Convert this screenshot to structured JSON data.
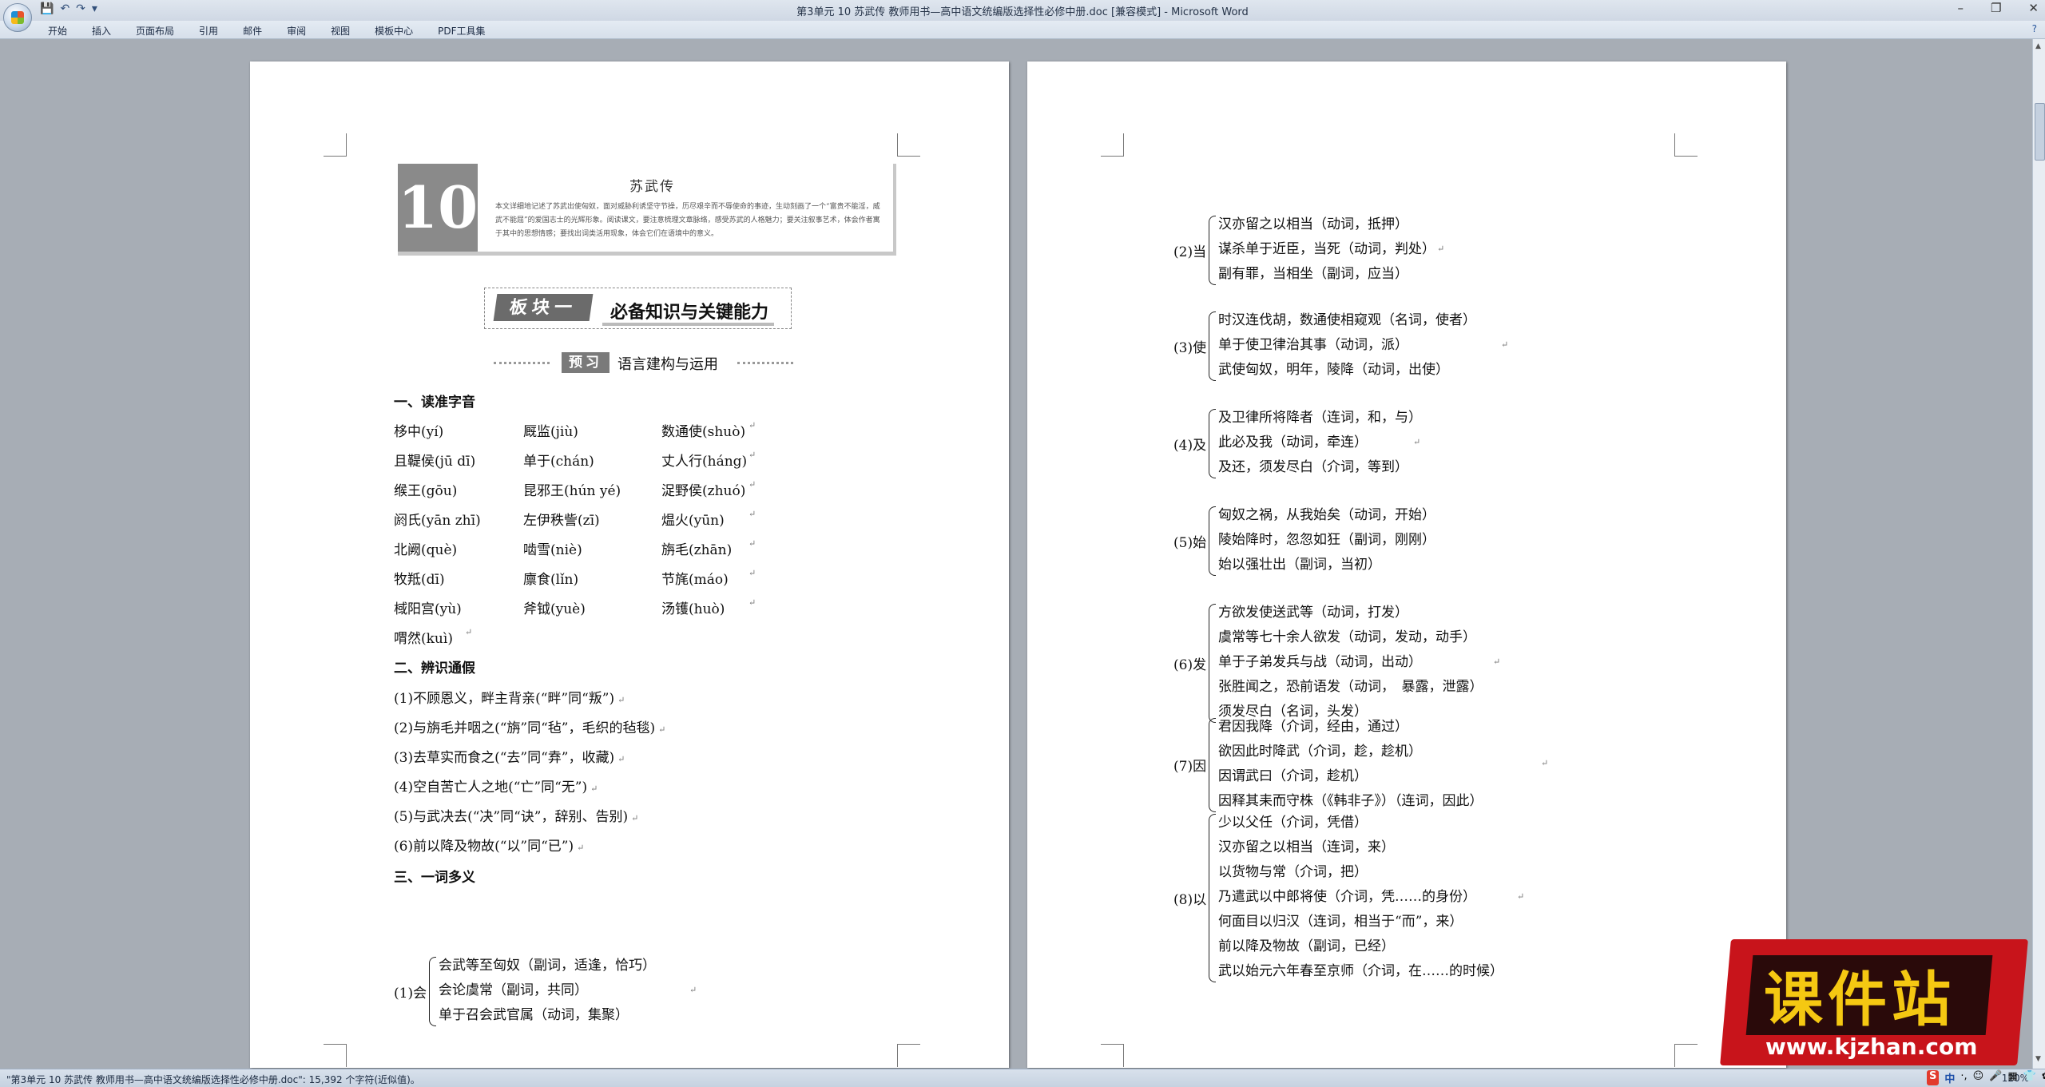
{
  "window": {
    "title": "第3单元 10 苏武传 教师用书—高中语文统编版选择性必修中册.doc [兼容模式] - Microsoft Word",
    "controls": [
      "–",
      "❐",
      "✕"
    ]
  },
  "menu": {
    "items": [
      "开始",
      "插入",
      "页面布局",
      "引用",
      "邮件",
      "审阅",
      "视图",
      "模板中心",
      "PDF工具集"
    ],
    "help": "?"
  },
  "left_page": {
    "lesson_number": "10",
    "lesson_title": "苏武传",
    "lesson_intro": "本文详细地记述了苏武出使匈奴，面对威胁利诱坚守节操，历尽艰辛而不辱使命的事迹，生动刻画了一个“富贵不能淫，威武不能屈”的爱国志士的光辉形象。阅读课文，要注意梳理文章脉络，感受苏武的人格魅力；要关注叙事艺术，体会作者寓于其中的思想情感；要找出词类活用现象，体会它们在语境中的意义。",
    "module_tag": "板块一",
    "module_title": "必备知识与关键能力",
    "preview_tag": "预习",
    "preview_title": "语言建构与运用",
    "sec1": "一、读准字音",
    "pron_rows": [
      [
        "栘中(yí)",
        "厩监(jiù)",
        "数通使(shuò)"
      ],
      [
        "且鞮侯(jū dī)",
        "单于(chán)",
        "丈人行(háng)"
      ],
      [
        "缑王(gōu)",
        "昆邪王(hún yé)",
        "浞野侯(zhuó)"
      ],
      [
        "阏氏(yān zhī)",
        "左伊秩訾(zī)",
        "煴火(yūn)"
      ],
      [
        "北阙(què)",
        "啮雪(niè)",
        "旃毛(zhān)"
      ],
      [
        "牧羝(dī)",
        "廪食(lǐn)",
        "节旄(máo)"
      ],
      [
        "棫阳宫(yù)",
        "斧钺(yuè)",
        "汤镬(huò)"
      ],
      [
        "喟然(kuì)",
        "",
        ""
      ]
    ],
    "sec2": "二、辨识通假",
    "tongjia": [
      "(1)不顾恩义，畔主背亲(“畔”同“叛”)",
      "(2)与旃毛并咽之(“旃”同“毡”，毛织的毡毯)",
      "(3)去草实而食之(“去”同“弆”，收藏)",
      "(4)空自苦亡人之地(“亡”同“无”)",
      "(5)与武决去(“决”同“诀”，辞别、告别)",
      "(6)前以降及物故(“以”同“已”)"
    ],
    "sec3": "三、一词多义",
    "hui": {
      "label": "(1)会",
      "items": [
        "会武等至匈奴（副词，适逢，恰巧）",
        "会论虞常（副词，共同）",
        "单于召会武官属（动词，集聚）"
      ]
    }
  },
  "right_page": {
    "groups": [
      {
        "label": "(2)当",
        "items": [
          "汉亦留之以相当（动词，抵押）",
          "谋杀单于近臣，当死（动词，判处）",
          "副有罪，当相坐（副词，应当）"
        ]
      },
      {
        "label": "(3)使",
        "items": [
          "时汉连伐胡，数通使相窥观（名词，使者）",
          "单于使卫律治其事（动词，派）",
          "武使匈奴，明年，陵降（动词，出使）"
        ]
      },
      {
        "label": "(4)及",
        "items": [
          "及卫律所将降者（连词，和，与）",
          "此必及我（动词，牵连）",
          "及还，须发尽白（介词，等到）"
        ]
      },
      {
        "label": "(5)始",
        "items": [
          "匈奴之祸，从我始矣（动词，开始）",
          "陵始降时，忽忽如狂（副词，刚刚）",
          "始以强壮出（副词，当初）"
        ]
      },
      {
        "label": "(6)发",
        "items": [
          "方欲发使送武等（动词，打发）",
          "虞常等七十余人欲发（动词，发动，动手）",
          "单于子弟发兵与战（动词，出动）",
          "张胜闻之，恐前语发（动词，　暴露，泄露）",
          "须发尽白（名词，头发）"
        ]
      },
      {
        "label": "(7)因",
        "items": [
          "君因我降（介词，经由，通过）",
          "欲因此时降武（介词，趁，趁机）",
          "因谓武曰（介词，趁机）",
          "因释其耒而守株（《韩非子》）（连词，因此）"
        ]
      },
      {
        "label": "(8)以",
        "items": [
          "少以父任（介词，凭借）",
          "汉亦留之以相当（连词，来）",
          "以货物与常（介词，把）",
          "乃遣武以中郎将使（介词，凭……的身份）",
          "何面目以归汉（连词，相当于“而”，来）",
          "前以降及物故（副词，已经）",
          "武以始元六年春至京师（介词，在……的时候）"
        ]
      }
    ]
  },
  "status": {
    "text": "\"第3单元 10 苏武传 教师用书—高中语文统编版选择性必修中册.doc\": 15,392 个字符(近似值)。",
    "zoom": "120%"
  },
  "ime": {
    "logo": "S",
    "lang": "中",
    "items": [
      "·,",
      "☺",
      "🎤",
      "▦",
      "👕",
      "✿"
    ]
  },
  "watermark": {
    "title": "课件站",
    "url": "www.kjzhan.com"
  },
  "para_mark": "↵"
}
